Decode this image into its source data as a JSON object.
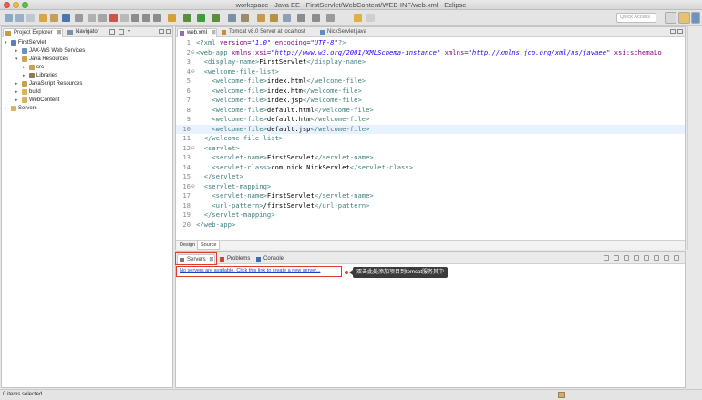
{
  "window": {
    "title": "workspace - Java EE - FirstServlet/WebContent/WEB-INF/web.xml - Eclipse"
  },
  "toolbar": {
    "quick_access_placeholder": "Quick Access"
  },
  "left_pane": {
    "tabs": [
      {
        "label": "Project Explorer",
        "close": "⊠"
      },
      {
        "label": "Navigator"
      }
    ],
    "tree": [
      {
        "label": "FirstServlet",
        "icon": "project-icon",
        "twisty": "▾"
      },
      {
        "label": "JAX-WS Web Services",
        "icon": "webservice-icon",
        "twisty": "▸"
      },
      {
        "label": "Java Resources",
        "icon": "java-resources-icon",
        "twisty": "▾"
      },
      {
        "label": "src",
        "icon": "package-folder-icon",
        "twisty": "▸"
      },
      {
        "label": "Libraries",
        "icon": "library-icon",
        "twisty": "▸"
      },
      {
        "label": "JavaScript Resources",
        "icon": "javascript-icon",
        "twisty": "▸"
      },
      {
        "label": "build",
        "icon": "folder-icon",
        "twisty": "▸"
      },
      {
        "label": "WebContent",
        "icon": "folder-icon",
        "twisty": "▸"
      },
      {
        "label": "Servers",
        "icon": "folder-icon",
        "twisty": "▸"
      }
    ]
  },
  "editor": {
    "tabs": [
      {
        "label": "web.xml",
        "close": "⊠"
      },
      {
        "label": "Tomcat v8.0 Server at localhost"
      },
      {
        "label": "NickServlet.java"
      }
    ],
    "bottom_tabs": [
      "Design",
      "Source"
    ],
    "lines": [
      {
        "n": "1",
        "fold": "",
        "html": "<span class=\"tag\">&lt;?xml</span> <span class=\"attr\">version</span>=<span class=\"val\">\"1.0\"</span> <span class=\"attr\">encoding</span>=<span class=\"val\">\"UTF-8\"</span><span class=\"tag\">?&gt;</span>"
      },
      {
        "n": "2",
        "fold": "⊖",
        "html": "<span class=\"tag\">&lt;web-app</span> <span class=\"attr\">xmlns:xsi</span>=<span class=\"val\">\"http://www.w3.org/2001/XMLSchema-instance\"</span> <span class=\"attr\">xmlns</span>=<span class=\"val\">\"http://xmlns.jcp.org/xml/ns/javaee\"</span> <span class=\"attr\">xsi:schemaLo</span>"
      },
      {
        "n": "3",
        "fold": "",
        "html": "  <span class=\"tag\">&lt;display-name&gt;</span><span class=\"txt\">FirstServlet</span><span class=\"tag\">&lt;/display-name&gt;</span>"
      },
      {
        "n": "4",
        "fold": "⊖",
        "html": "  <span class=\"tag\">&lt;welcome-file-list&gt;</span>"
      },
      {
        "n": "5",
        "fold": "",
        "html": "    <span class=\"tag\">&lt;welcome-file&gt;</span><span class=\"txt\">index.html</span><span class=\"tag\">&lt;/welcome-file&gt;</span>"
      },
      {
        "n": "6",
        "fold": "",
        "html": "    <span class=\"tag\">&lt;welcome-file&gt;</span><span class=\"txt\">index.htm</span><span class=\"tag\">&lt;/welcome-file&gt;</span>"
      },
      {
        "n": "7",
        "fold": "",
        "html": "    <span class=\"tag\">&lt;welcome-file&gt;</span><span class=\"txt\">index.jsp</span><span class=\"tag\">&lt;/welcome-file&gt;</span>"
      },
      {
        "n": "8",
        "fold": "",
        "html": "    <span class=\"tag\">&lt;welcome-file&gt;</span><span class=\"txt\">default.html</span><span class=\"tag\">&lt;/welcome-file&gt;</span>"
      },
      {
        "n": "9",
        "fold": "",
        "html": "    <span class=\"tag\">&lt;welcome-file&gt;</span><span class=\"txt\">default.htm</span><span class=\"tag\">&lt;/welcome-file&gt;</span>"
      },
      {
        "n": "10",
        "fold": "",
        "html": "    <span class=\"tag\">&lt;welcome-file&gt;</span><span class=\"txt\">default.jsp</span><span class=\"tag\">&lt;/welcome-file&gt;</span>",
        "current": true
      },
      {
        "n": "11",
        "fold": "",
        "html": "  <span class=\"tag\">&lt;/welcome-file-list&gt;</span>"
      },
      {
        "n": "12",
        "fold": "⊖",
        "html": "  <span class=\"tag\">&lt;servlet&gt;</span>"
      },
      {
        "n": "13",
        "fold": "",
        "html": "    <span class=\"tag\">&lt;servlet-name&gt;</span><span class=\"txt\">FirstServlet</span><span class=\"tag\">&lt;/servlet-name&gt;</span>"
      },
      {
        "n": "14",
        "fold": "",
        "html": "    <span class=\"tag\">&lt;servlet-class&gt;</span><span class=\"txt\">com.nick.NickServlet</span><span class=\"tag\">&lt;/servlet-class&gt;</span>"
      },
      {
        "n": "15",
        "fold": "",
        "html": "  <span class=\"tag\">&lt;/servlet&gt;</span>"
      },
      {
        "n": "16",
        "fold": "⊖",
        "html": "  <span class=\"tag\">&lt;servlet-mapping&gt;</span>"
      },
      {
        "n": "17",
        "fold": "",
        "html": "    <span class=\"tag\">&lt;servlet-name&gt;</span><span class=\"txt\">FirstServlet</span><span class=\"tag\">&lt;/servlet-name&gt;</span>"
      },
      {
        "n": "18",
        "fold": "",
        "html": "    <span class=\"tag\">&lt;url-pattern&gt;</span><span class=\"txt\">/firstServlet</span><span class=\"tag\">&lt;/url-pattern&gt;</span>"
      },
      {
        "n": "19",
        "fold": "",
        "html": "  <span class=\"tag\">&lt;/servlet-mapping&gt;</span>"
      },
      {
        "n": "20",
        "fold": "",
        "html": "<span class=\"tag\">&lt;/web-app&gt;</span>"
      }
    ]
  },
  "servers_view": {
    "tabs": [
      {
        "label": "Servers",
        "close": "⊠"
      },
      {
        "label": "Problems"
      },
      {
        "label": "Console"
      }
    ],
    "link": "No servers are available. Click this link to create a new server...",
    "callout": "双击此处添加项目到tomcat服务其中"
  },
  "status": {
    "text": "0 items selected"
  },
  "colors": {
    "highlight_box": "#e23b2e",
    "xml_tag": "#3f7f7f",
    "xml_attr": "#7f007f",
    "xml_value": "#2a00ff",
    "link": "#1a3fc4"
  }
}
